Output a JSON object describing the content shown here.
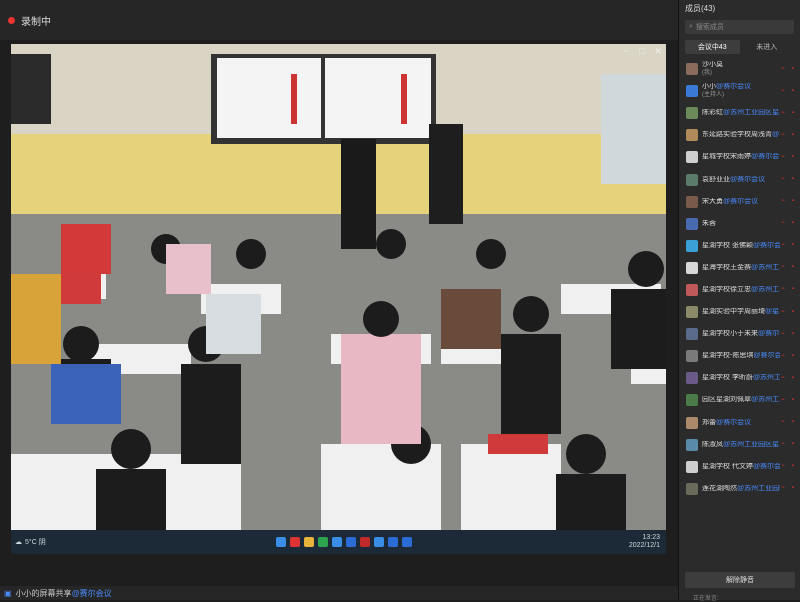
{
  "recording": {
    "label": "录制中"
  },
  "taskbar": {
    "weather": "5°C 阴",
    "time": "13:23",
    "date": "2022/12/1"
  },
  "share": {
    "label": "小小的屏幕共享",
    "org": "@赛尔会议"
  },
  "sidebar": {
    "title": "成员(43)",
    "search_placeholder": "搜索成员",
    "tabs": [
      {
        "label": "会议中43"
      },
      {
        "label": "未进入"
      }
    ],
    "members": [
      {
        "name": "沙小莫",
        "org": "",
        "role": "(我)"
      },
      {
        "name": "小小",
        "org": "@赛尔会议",
        "role": "(主持人)"
      },
      {
        "name": "陈彩虹",
        "org": "@苏州工业园区星...",
        "role": ""
      },
      {
        "name": "东延路实验学校周浅青",
        "org": "@...",
        "role": ""
      },
      {
        "name": "星城学校宋雨婷",
        "org": "@赛尔会议",
        "role": ""
      },
      {
        "name": "袁舒亚亚",
        "org": "@赛尔会议",
        "role": ""
      },
      {
        "name": "宋大勇",
        "org": "@赛尔会议",
        "role": ""
      },
      {
        "name": "朱蓉",
        "org": "",
        "role": ""
      },
      {
        "name": "星湖学校 张佛颖",
        "org": "@赛尔会议",
        "role": ""
      },
      {
        "name": "星海学校王金赛",
        "org": "@苏州工...",
        "role": ""
      },
      {
        "name": "星湖学校徐立忠",
        "org": "@苏州工...",
        "role": ""
      },
      {
        "name": "星湖实验中学周丽琦",
        "org": "@星...",
        "role": ""
      },
      {
        "name": "星湖学校小于未来",
        "org": "@赛尔会议",
        "role": ""
      },
      {
        "name": "星湖学校-陈思琪",
        "org": "@赛尔会议",
        "role": ""
      },
      {
        "name": "星湖学校 李昕蔚",
        "org": "@苏州工...",
        "role": ""
      },
      {
        "name": "园区星湖刘佩翠",
        "org": "@苏州工...",
        "role": ""
      },
      {
        "name": "郑蕾",
        "org": "@赛尔会议",
        "role": ""
      },
      {
        "name": "陈淑凤",
        "org": "@苏州工业园区星...",
        "role": ""
      },
      {
        "name": "星湖学校 代文婷",
        "org": "@赛尔会议",
        "role": ""
      },
      {
        "name": "莲花湖陶然",
        "org": "@苏州工业园区星...",
        "role": ""
      }
    ],
    "unmute_all": "解除静音",
    "footer": "正在发言:"
  },
  "colors": {
    "accent": "#4a8cff",
    "recording": "#e33333",
    "muted": "#cc3333"
  }
}
